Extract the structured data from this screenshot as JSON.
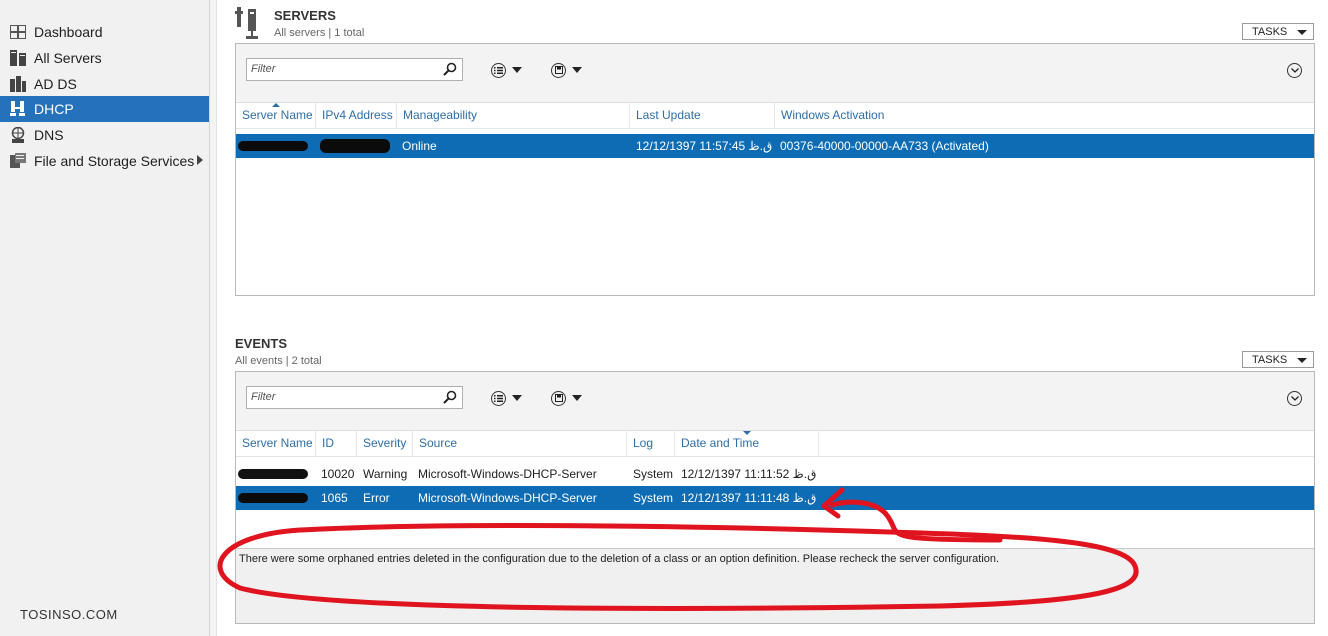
{
  "sidebar": {
    "items": [
      {
        "label": "Dashboard",
        "icon": "dashboard-icon",
        "active": false
      },
      {
        "label": "All Servers",
        "icon": "servers-icon",
        "active": false
      },
      {
        "label": "AD DS",
        "icon": "adds-icon",
        "active": false
      },
      {
        "label": "DHCP",
        "icon": "dhcp-icon",
        "active": true
      },
      {
        "label": "DNS",
        "icon": "dns-icon",
        "active": false
      },
      {
        "label": "File and Storage Services",
        "icon": "storage-icon",
        "active": false,
        "has_submenu": true
      }
    ],
    "active_color": "#2672ba"
  },
  "watermark": "TOSINSO.COM",
  "servers": {
    "title": "SERVERS",
    "subtitle": "All servers | 1 total",
    "tasks_label": "TASKS",
    "filter_placeholder": "Filter",
    "columns": [
      "Server Name",
      "IPv4 Address",
      "Manageability",
      "Last Update",
      "Windows Activation"
    ],
    "rows": [
      {
        "server_name": "",
        "ipv4": "",
        "manageability": "Online",
        "last_update": "12/12/1397 11:57:45 ق.ظ",
        "activation": "00376-40000-00000-AA733 (Activated)",
        "selected": true
      }
    ]
  },
  "events": {
    "title": "EVENTS",
    "subtitle": "All events | 2 total",
    "tasks_label": "TASKS",
    "filter_placeholder": "Filter",
    "columns": [
      "Server Name",
      "ID",
      "Severity",
      "Source",
      "Log",
      "Date and Time"
    ],
    "rows": [
      {
        "server_name": "",
        "id": "10020",
        "severity": "Warning",
        "source": "Microsoft-Windows-DHCP-Server",
        "log": "System",
        "date_time": "12/12/1397 11:11:52 ق.ظ",
        "selected": false
      },
      {
        "server_name": "",
        "id": "1065",
        "severity": "Error",
        "source": "Microsoft-Windows-DHCP-Server",
        "log": "System",
        "date_time": "12/12/1397 11:11:48 ق.ظ",
        "selected": true
      }
    ],
    "details_text": "There were some orphaned entries deleted in the configuration due to the deletion of a class or an option definition. Please recheck the server configuration."
  },
  "colors": {
    "selection": "#0d6cb3",
    "column_header": "#2e6ea6",
    "annotation": "#e0141e"
  }
}
